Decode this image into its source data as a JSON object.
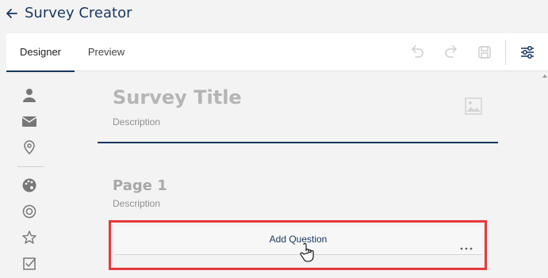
{
  "header": {
    "title": "Survey Creator"
  },
  "tabs": [
    {
      "label": "Designer",
      "active": true
    },
    {
      "label": "Preview",
      "active": false
    }
  ],
  "toolbar": {
    "icons": [
      "undo-icon",
      "redo-icon",
      "save-icon",
      "settings-icon"
    ]
  },
  "toolbox": {
    "items": [
      "person-icon",
      "mail-icon",
      "location-icon",
      "palette-icon",
      "radio-icon",
      "star-icon",
      "checkbox-icon"
    ]
  },
  "survey": {
    "title": "Survey Title",
    "description": "Description",
    "page": {
      "title": "Page 1",
      "description": "Description",
      "add_question_label": "Add Question"
    }
  },
  "colors": {
    "accent": "#17375e",
    "highlight": "#e5393b"
  }
}
